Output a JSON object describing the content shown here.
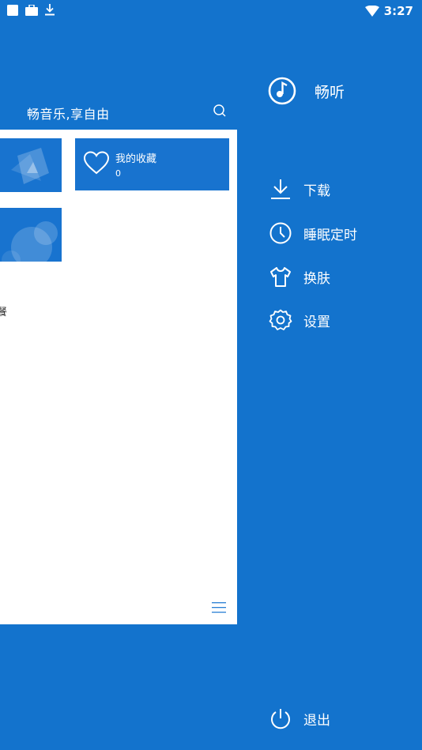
{
  "status_bar": {
    "time": "3:27",
    "icons": [
      "square-icon",
      "bag-icon",
      "download-arrow-icon",
      "wifi-icon"
    ]
  },
  "main": {
    "slogan": "畅音乐,享自由",
    "favorites": {
      "label": "我的收藏",
      "count": "0"
    },
    "cut_text_1": "餐",
    "cut_text_2": "!"
  },
  "drawer": {
    "brand_name": "畅听",
    "menu": [
      {
        "label": "下载",
        "icon": "download-icon"
      },
      {
        "label": "睡眠定时",
        "icon": "clock-icon"
      },
      {
        "label": "换肤",
        "icon": "shirt-icon"
      },
      {
        "label": "设置",
        "icon": "gear-icon"
      }
    ],
    "exit_label": "退出"
  },
  "colors": {
    "primary_blue": "#1373CD",
    "tile_blue": "#1873CF",
    "white": "#ffffff"
  }
}
